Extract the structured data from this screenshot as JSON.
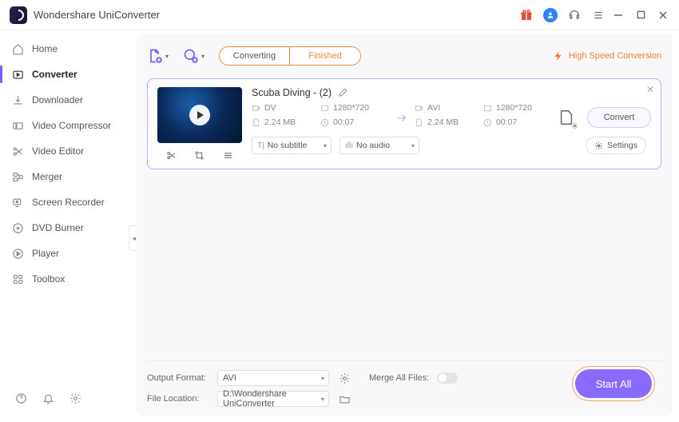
{
  "app": {
    "title": "Wondershare UniConverter"
  },
  "sidebar": {
    "items": [
      {
        "label": "Home"
      },
      {
        "label": "Converter"
      },
      {
        "label": "Downloader"
      },
      {
        "label": "Video Compressor"
      },
      {
        "label": "Video Editor"
      },
      {
        "label": "Merger"
      },
      {
        "label": "Screen Recorder"
      },
      {
        "label": "DVD Burner"
      },
      {
        "label": "Player"
      },
      {
        "label": "Toolbox"
      }
    ]
  },
  "tabs": {
    "converting": "Converting",
    "finished": "Finished"
  },
  "hsc": {
    "label": "High Speed Conversion"
  },
  "file": {
    "name": "Scuba Diving - (2)",
    "src": {
      "format": "DV",
      "resolution": "1280*720",
      "size": "2.24 MB",
      "duration": "00:07"
    },
    "dst": {
      "format": "AVI",
      "resolution": "1280*720",
      "size": "2.24 MB",
      "duration": "00:07"
    },
    "subtitle": "No subtitle",
    "audio": "No audio",
    "settings_label": "Settings",
    "convert_label": "Convert"
  },
  "footer": {
    "output_format_label": "Output Format:",
    "output_format_value": "AVI",
    "file_location_label": "File Location:",
    "file_location_value": "D:\\Wondershare UniConverter",
    "merge_label": "Merge All Files:",
    "start_label": "Start All"
  }
}
